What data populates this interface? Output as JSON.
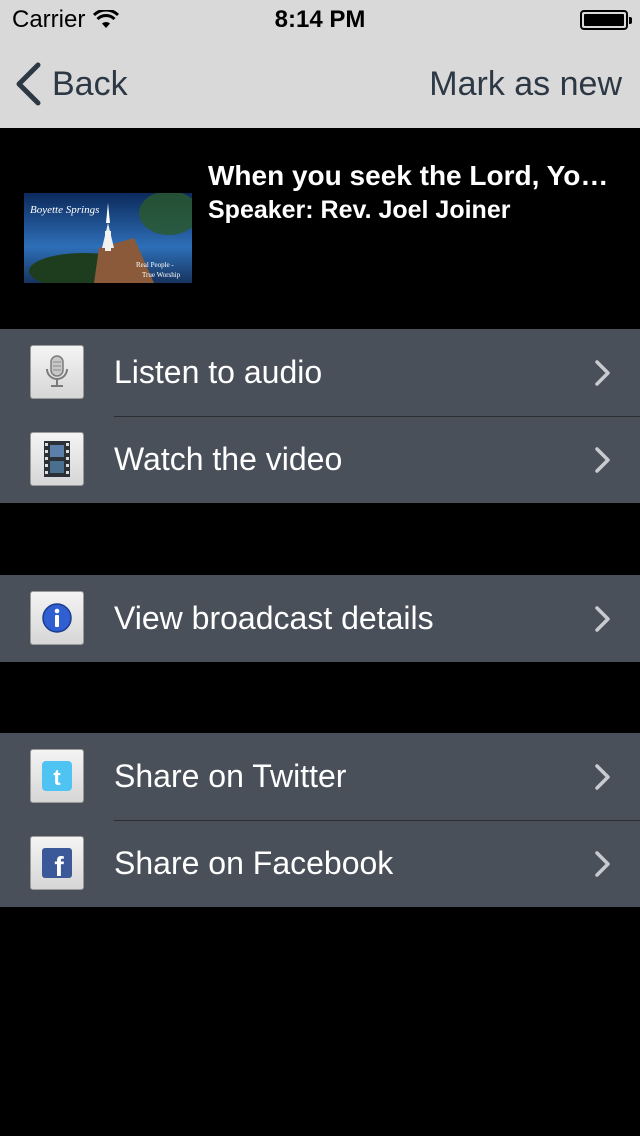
{
  "status_bar": {
    "carrier": "Carrier",
    "time": "8:14 PM"
  },
  "nav": {
    "back_label": "Back",
    "mark_new_label": "Mark as new"
  },
  "episode": {
    "title": "When you seek the Lord, Yo…",
    "speaker": "Speaker: Rev. Joel Joiner",
    "thumbnail_text": {
      "church_name": "Boyette Springs",
      "tagline_line1": "Real People -",
      "tagline_line2": "True Worship"
    }
  },
  "rows": {
    "listen_audio": {
      "label": "Listen to audio",
      "icon": "microphone-icon"
    },
    "watch_video": {
      "label": "Watch the video",
      "icon": "film-icon"
    },
    "broadcast_details": {
      "label": "View broadcast details",
      "icon": "info-icon"
    },
    "share_twitter": {
      "label": "Share on Twitter",
      "icon": "twitter-icon"
    },
    "share_facebook": {
      "label": "Share on Facebook",
      "icon": "facebook-icon"
    }
  },
  "colors": {
    "bars_background": "#d9d9d9",
    "nav_text": "#2d3845",
    "row_background": "#4a5059",
    "page_background": "#000000",
    "info_blue": "#2f5fd0",
    "facebook_blue": "#3b5998",
    "twitter_blue": "#4fc3f2"
  }
}
